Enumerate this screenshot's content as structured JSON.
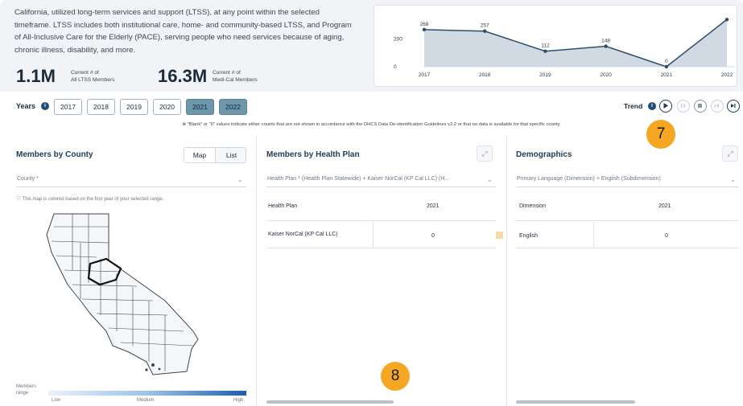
{
  "header": {
    "intro_text": "California, utilized long-term services and support (LTSS), at any point within the selected timeframe. LTSS includes both institutional care, home- and community-based LTSS, and Program of All-Inclusive Care for the Elderly (PACE), serving people who need services because of aging, chronic illness, disability, and more.",
    "stat1_value": "1.1M",
    "stat1_caption_1": "Current # of",
    "stat1_caption_2": "All LTSS Members",
    "stat2_value": "16.3M",
    "stat2_caption_1": "Current # of",
    "stat2_caption_2": "Medi-Cal Members"
  },
  "chart_data": {
    "type": "area",
    "categories": [
      "2017",
      "2018",
      "2019",
      "2020",
      "2021",
      "2022"
    ],
    "values": [
      268,
      257,
      112,
      148,
      0,
      341
    ],
    "data_labels": [
      "268",
      "257",
      "112",
      "148",
      "0",
      ""
    ],
    "y_ticks": [
      "200",
      "0"
    ],
    "ylim": [
      0,
      360
    ],
    "grid": false,
    "colors": {
      "line": "#2d4d6b",
      "fill": "#c9d3de"
    }
  },
  "years": {
    "label": "Years",
    "buttons": [
      {
        "label": "2017",
        "selected": false
      },
      {
        "label": "2018",
        "selected": false
      },
      {
        "label": "2019",
        "selected": false
      },
      {
        "label": "2020",
        "selected": false
      },
      {
        "label": "2021",
        "selected": true
      },
      {
        "label": "2022",
        "selected": true
      }
    ],
    "trend_label": "Trend",
    "controls": [
      "play-icon",
      "pause-icon",
      "stop-icon",
      "skip-back-icon",
      "skip-forward-icon"
    ]
  },
  "notice": "※ \"Blank\" or \"0\" values indicate either counts that are not shown in accordance with the DHCS Data De-identification Guidelines v2.2 or that no data is available for that specific county.",
  "county_panel": {
    "title": "Members by County",
    "toggle_map": "Map",
    "toggle_list": "List",
    "select_placeholder": "County *",
    "map_note": "ⓘ This map is colored based on the first year of your selected range.",
    "legend_title_1": "Members",
    "legend_title_2": "range",
    "legend_low": "Low",
    "legend_medium": "Medium",
    "legend_high": "High"
  },
  "health_plan_panel": {
    "title": "Members by Health Plan",
    "select_value": "Health Plan * (Health Plan Statewide) + Kaiser NorCal (KP Cal LLC) (H...",
    "column_1": "Health Plan",
    "column_2": "2021",
    "rows": [
      {
        "name": "Kaiser NorCal (KP Cal LLC)",
        "value": "0"
      }
    ]
  },
  "demographics_panel": {
    "title": "Demographics",
    "select_value": "Primary Language (Dimension) + English (Subdimension)",
    "column_1": "Dimension",
    "column_2": "2021",
    "rows": [
      {
        "name": "English",
        "value": "0"
      }
    ]
  },
  "callouts": {
    "badge_7": "7",
    "badge_8": "8"
  },
  "colors": {
    "accent": "#1f3b57",
    "selected_year": "#6f97ab",
    "badge": "#f5a623"
  }
}
